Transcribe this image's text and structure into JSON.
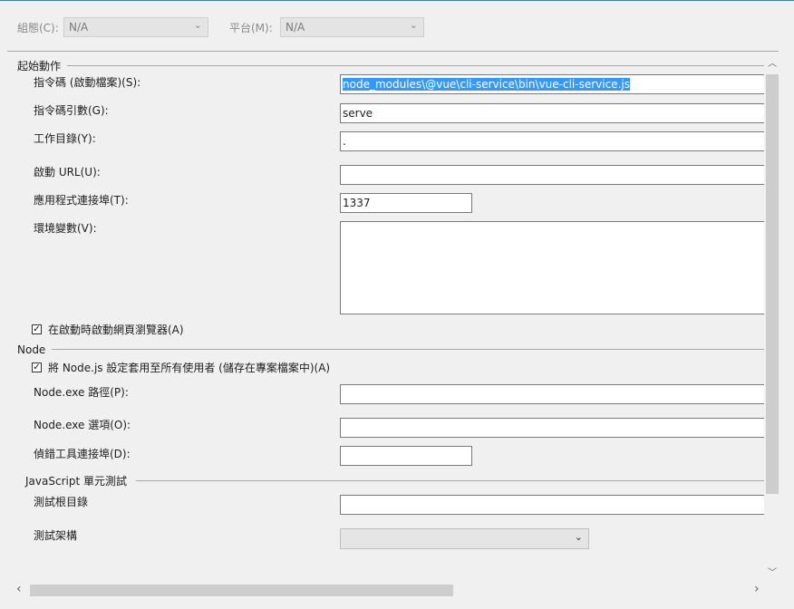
{
  "config": {
    "config_label": "組態(C):",
    "config_value": "N/A",
    "platform_label": "平台(M):",
    "platform_value": "N/A"
  },
  "startup": {
    "section_title": "起始動作",
    "script_label": "指令碼 (啟動檔案)(S):",
    "script_value": "node_modules\\@vue\\cli-service\\bin\\vue-cli-service.js",
    "args_label": "指令碼引數(G):",
    "args_value": "serve",
    "workdir_label": "工作目錄(Y):",
    "workdir_value": ".",
    "launch_url_label": "啟動 URL(U):",
    "launch_url_value": "",
    "port_label": "應用程式連接埠(T):",
    "port_value": "1337",
    "env_label": "環境變數(V):",
    "env_value": "",
    "open_browser_label": "在啟動時啟動網頁瀏覽器(A)",
    "open_browser_checked": true
  },
  "node": {
    "section_title": "Node",
    "apply_all_label": "將 Node.js 設定套用至所有使用者 (儲存在專案檔案中)(A)",
    "apply_all_checked": true,
    "exe_path_label": "Node.exe 路徑(P):",
    "exe_path_value": "",
    "exe_options_label": "Node.exe 選項(O):",
    "exe_options_value": "",
    "debugger_port_label": "偵錯工具連接埠(D):",
    "debugger_port_value": ""
  },
  "unit_test": {
    "section_title": "JavaScript 單元測試",
    "root_label": "測試根目錄",
    "root_value": "",
    "framework_label": "測試架構",
    "framework_value": ""
  },
  "icons": {
    "check": "✓",
    "chevron_down": "⌄",
    "scroll_up": "︿",
    "scroll_down": "﹀",
    "scroll_left": "‹",
    "scroll_right": "›"
  },
  "colors": {
    "selection": "#3399ff",
    "accent_line": "#3c7fb1"
  }
}
